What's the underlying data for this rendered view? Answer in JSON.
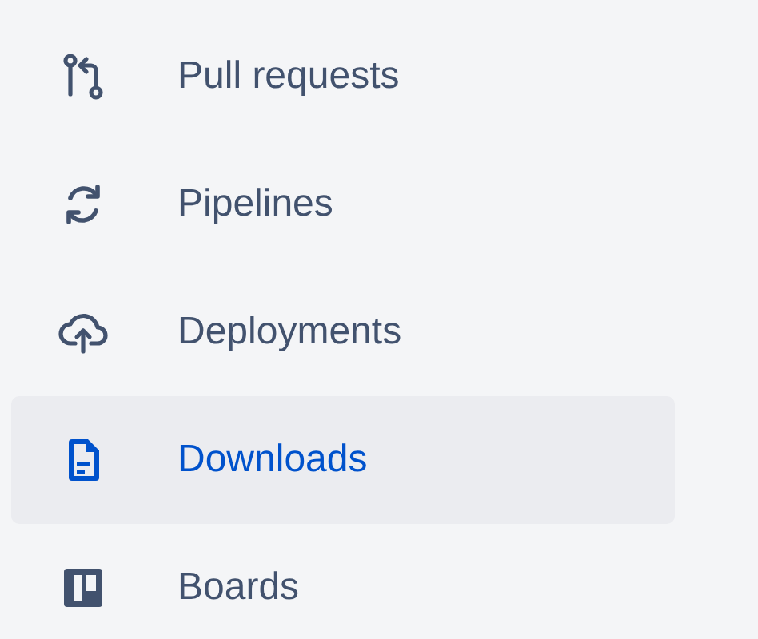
{
  "nav": {
    "items": [
      {
        "label": "Pull requests",
        "selected": false
      },
      {
        "label": "Pipelines",
        "selected": false
      },
      {
        "label": "Deployments",
        "selected": false
      },
      {
        "label": "Downloads",
        "selected": true
      },
      {
        "label": "Boards",
        "selected": false
      }
    ]
  }
}
